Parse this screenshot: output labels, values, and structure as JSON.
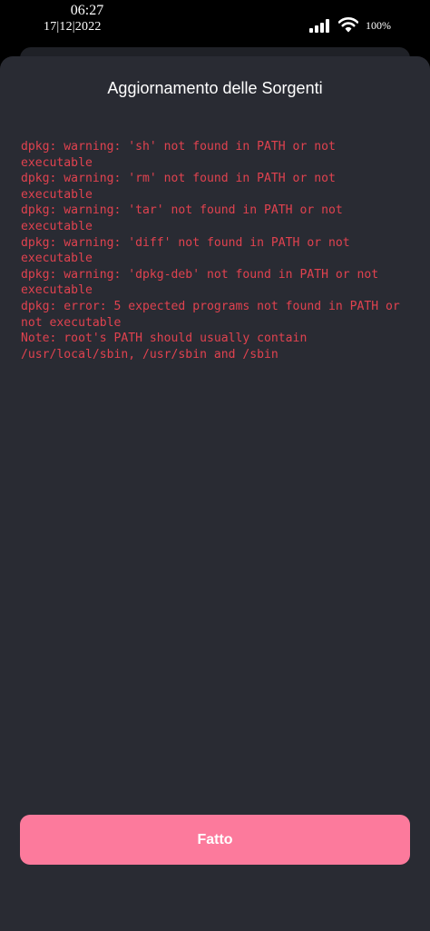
{
  "status_bar": {
    "time": "06:27",
    "date": "17|12|2022",
    "battery": "100%",
    "icons": [
      "signal-icon",
      "wifi-icon"
    ]
  },
  "sheet": {
    "title": "Aggiornamento delle Sorgenti",
    "log_lines": [
      "dpkg: warning: 'sh' not found in PATH or not executable",
      "dpkg: warning: 'rm' not found in PATH or not executable",
      "dpkg: warning: 'tar' not found in PATH or not executable",
      "dpkg: warning: 'diff' not found in PATH or not executable",
      "dpkg: warning: 'dpkg-deb' not found in PATH or not executable",
      "dpkg: error: 5 expected programs not found in PATH or not executable",
      "Note: root's PATH should usually contain /usr/local/sbin, /usr/sbin and /sbin"
    ],
    "done_label": "Fatto"
  },
  "colors": {
    "background": "#292b33",
    "log_text": "#e0424f",
    "button": "#fc7a9c",
    "title": "#ffffff"
  }
}
